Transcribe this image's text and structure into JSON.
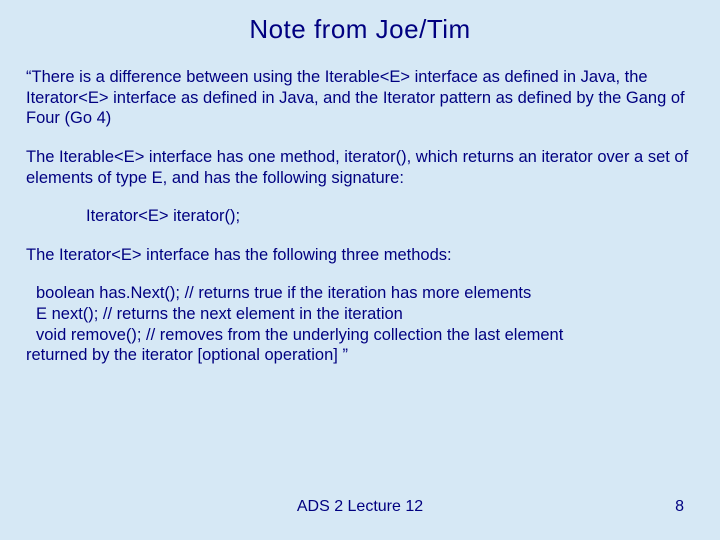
{
  "title": "Note from Joe/Tim",
  "para1": "“There is a difference between using the Iterable<E> interface as defined in Java, the Iterator<E> interface as defined in Java, and the Iterator pattern as defined by the Gang of Four (Go 4)",
  "para2": "The Iterable<E> interface has one method, iterator(), which returns an iterator over a set of elements of type E, and has the following signature:",
  "code1": "Iterator<E> iterator();",
  "para3": "The Iterator<E> interface has the following three methods:",
  "line1": "boolean has.Next(); // returns true if the iteration has more elements",
  "line2": "E next(); // returns the next element in the iteration",
  "line3": "void remove(); // removes from the underlying collection the last element",
  "line4": "returned by the iterator [optional operation] ”",
  "footer_center": "ADS 2 Lecture 12",
  "footer_right": "8"
}
